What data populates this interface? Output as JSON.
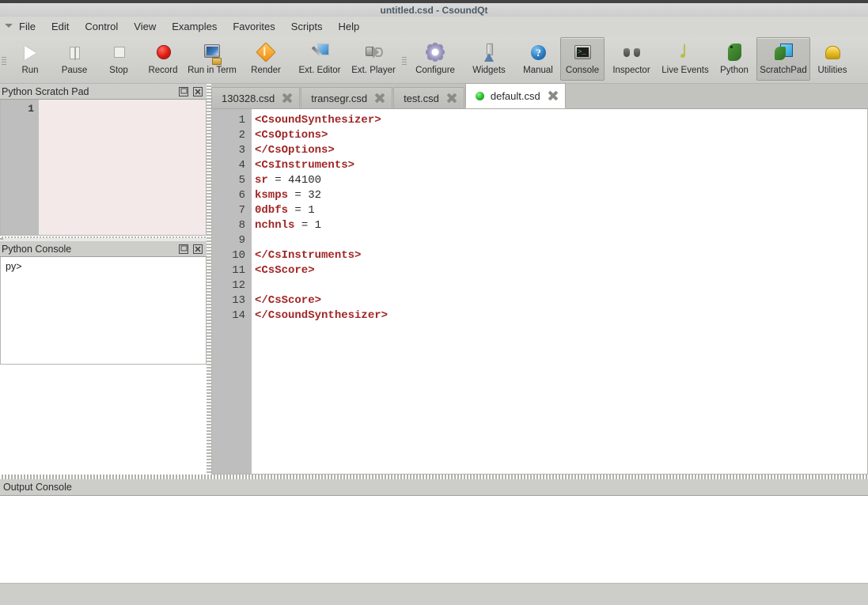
{
  "window": {
    "title": "untitled.csd - CsoundQt"
  },
  "menubar": {
    "items": [
      {
        "label": "File"
      },
      {
        "label": "Edit"
      },
      {
        "label": "Control"
      },
      {
        "label": "View"
      },
      {
        "label": "Examples"
      },
      {
        "label": "Favorites"
      },
      {
        "label": "Scripts"
      },
      {
        "label": "Help"
      }
    ]
  },
  "toolbar": {
    "buttons": [
      {
        "label": "Run",
        "icon": "play-icon",
        "state": "disabled"
      },
      {
        "label": "Pause",
        "icon": "pause-icon",
        "state": "disabled"
      },
      {
        "label": "Stop",
        "icon": "stop-icon",
        "state": "disabled"
      },
      {
        "label": "Record",
        "icon": "record-icon",
        "state": "normal"
      },
      {
        "label": "Run in Term",
        "icon": "terminal-icon",
        "state": "normal"
      },
      {
        "label": "Render",
        "icon": "render-icon",
        "state": "normal"
      },
      {
        "label": "Ext. Editor",
        "icon": "ext-editor-icon",
        "state": "normal"
      },
      {
        "label": "Ext. Player",
        "icon": "ext-player-icon",
        "state": "normal"
      },
      {
        "label": "Configure",
        "icon": "gear-icon",
        "state": "normal"
      },
      {
        "label": "Widgets",
        "icon": "widgets-icon",
        "state": "normal"
      },
      {
        "label": "Manual",
        "icon": "help-icon",
        "state": "normal"
      },
      {
        "label": "Console",
        "icon": "console-icon",
        "state": "active"
      },
      {
        "label": "Inspector",
        "icon": "binoculars-icon",
        "state": "normal"
      },
      {
        "label": "Live Events",
        "icon": "music-note-icon",
        "state": "normal"
      },
      {
        "label": "Python",
        "icon": "python-icon",
        "state": "active"
      },
      {
        "label": "ScratchPad",
        "icon": "scratchpad-icon",
        "state": "active"
      },
      {
        "label": "Utilities",
        "icon": "utilities-icon",
        "state": "normal"
      }
    ]
  },
  "docks": {
    "scratchpad": {
      "title": "Python Scratch Pad",
      "line_numbers": [
        "1"
      ],
      "content": ""
    },
    "python_console": {
      "title": "Python Console",
      "prompt": "py>"
    },
    "output_console": {
      "title": "Output Console",
      "content": ""
    }
  },
  "editor": {
    "tabs": [
      {
        "label": "130328.csd",
        "active": false,
        "modified": false
      },
      {
        "label": "transegr.csd",
        "active": false,
        "modified": false
      },
      {
        "label": "test.csd",
        "active": false,
        "modified": false
      },
      {
        "label": "default.csd",
        "active": true,
        "modified": true
      }
    ],
    "line_numbers": [
      "1",
      "2",
      "3",
      "4",
      "5",
      "6",
      "7",
      "8",
      "9",
      "10",
      "11",
      "12",
      "13",
      "14"
    ],
    "lines": [
      {
        "n": "1",
        "tokens": [
          {
            "t": "<CsoundSynthesizer>",
            "c": "tag"
          }
        ]
      },
      {
        "n": "2",
        "tokens": [
          {
            "t": "<CsOptions>",
            "c": "tag"
          }
        ]
      },
      {
        "n": "3",
        "tokens": [
          {
            "t": "</CsOptions>",
            "c": "tag"
          }
        ]
      },
      {
        "n": "4",
        "tokens": [
          {
            "t": "<CsInstruments>",
            "c": "tag"
          }
        ]
      },
      {
        "n": "5",
        "tokens": [
          {
            "t": "sr",
            "c": "kw"
          },
          {
            "t": " = 44100",
            "c": "plain"
          }
        ]
      },
      {
        "n": "6",
        "tokens": [
          {
            "t": "ksmps",
            "c": "kw"
          },
          {
            "t": " = 32",
            "c": "plain"
          }
        ]
      },
      {
        "n": "7",
        "tokens": [
          {
            "t": "0dbfs",
            "c": "kw"
          },
          {
            "t": " = 1",
            "c": "plain"
          }
        ]
      },
      {
        "n": "8",
        "tokens": [
          {
            "t": "nchnls",
            "c": "kw"
          },
          {
            "t": " = 1",
            "c": "plain"
          }
        ]
      },
      {
        "n": "9",
        "tokens": []
      },
      {
        "n": "10",
        "tokens": [
          {
            "t": "</CsInstruments>",
            "c": "tag"
          }
        ]
      },
      {
        "n": "11",
        "tokens": [
          {
            "t": "<CsScore>",
            "c": "tag"
          }
        ]
      },
      {
        "n": "12",
        "tokens": []
      },
      {
        "n": "13",
        "tokens": [
          {
            "t": "</CsScore>",
            "c": "tag"
          }
        ]
      },
      {
        "n": "14",
        "tokens": [
          {
            "t": "</CsoundSynthesizer>",
            "c": "tag"
          }
        ]
      }
    ]
  },
  "colors": {
    "tag": "#a02626",
    "keyword": "#a02626",
    "plain": "#2b2b2b",
    "toolbar_bg": "#d2d2ce",
    "dock_header_bg": "#cdcdc9",
    "gutter_bg": "#bebebe",
    "scratchpad_bg": "#f2e9e8",
    "tab_active_bg": "#ffffff",
    "modified_dot": "#2ab82a",
    "title_text": "#4b5a66"
  }
}
